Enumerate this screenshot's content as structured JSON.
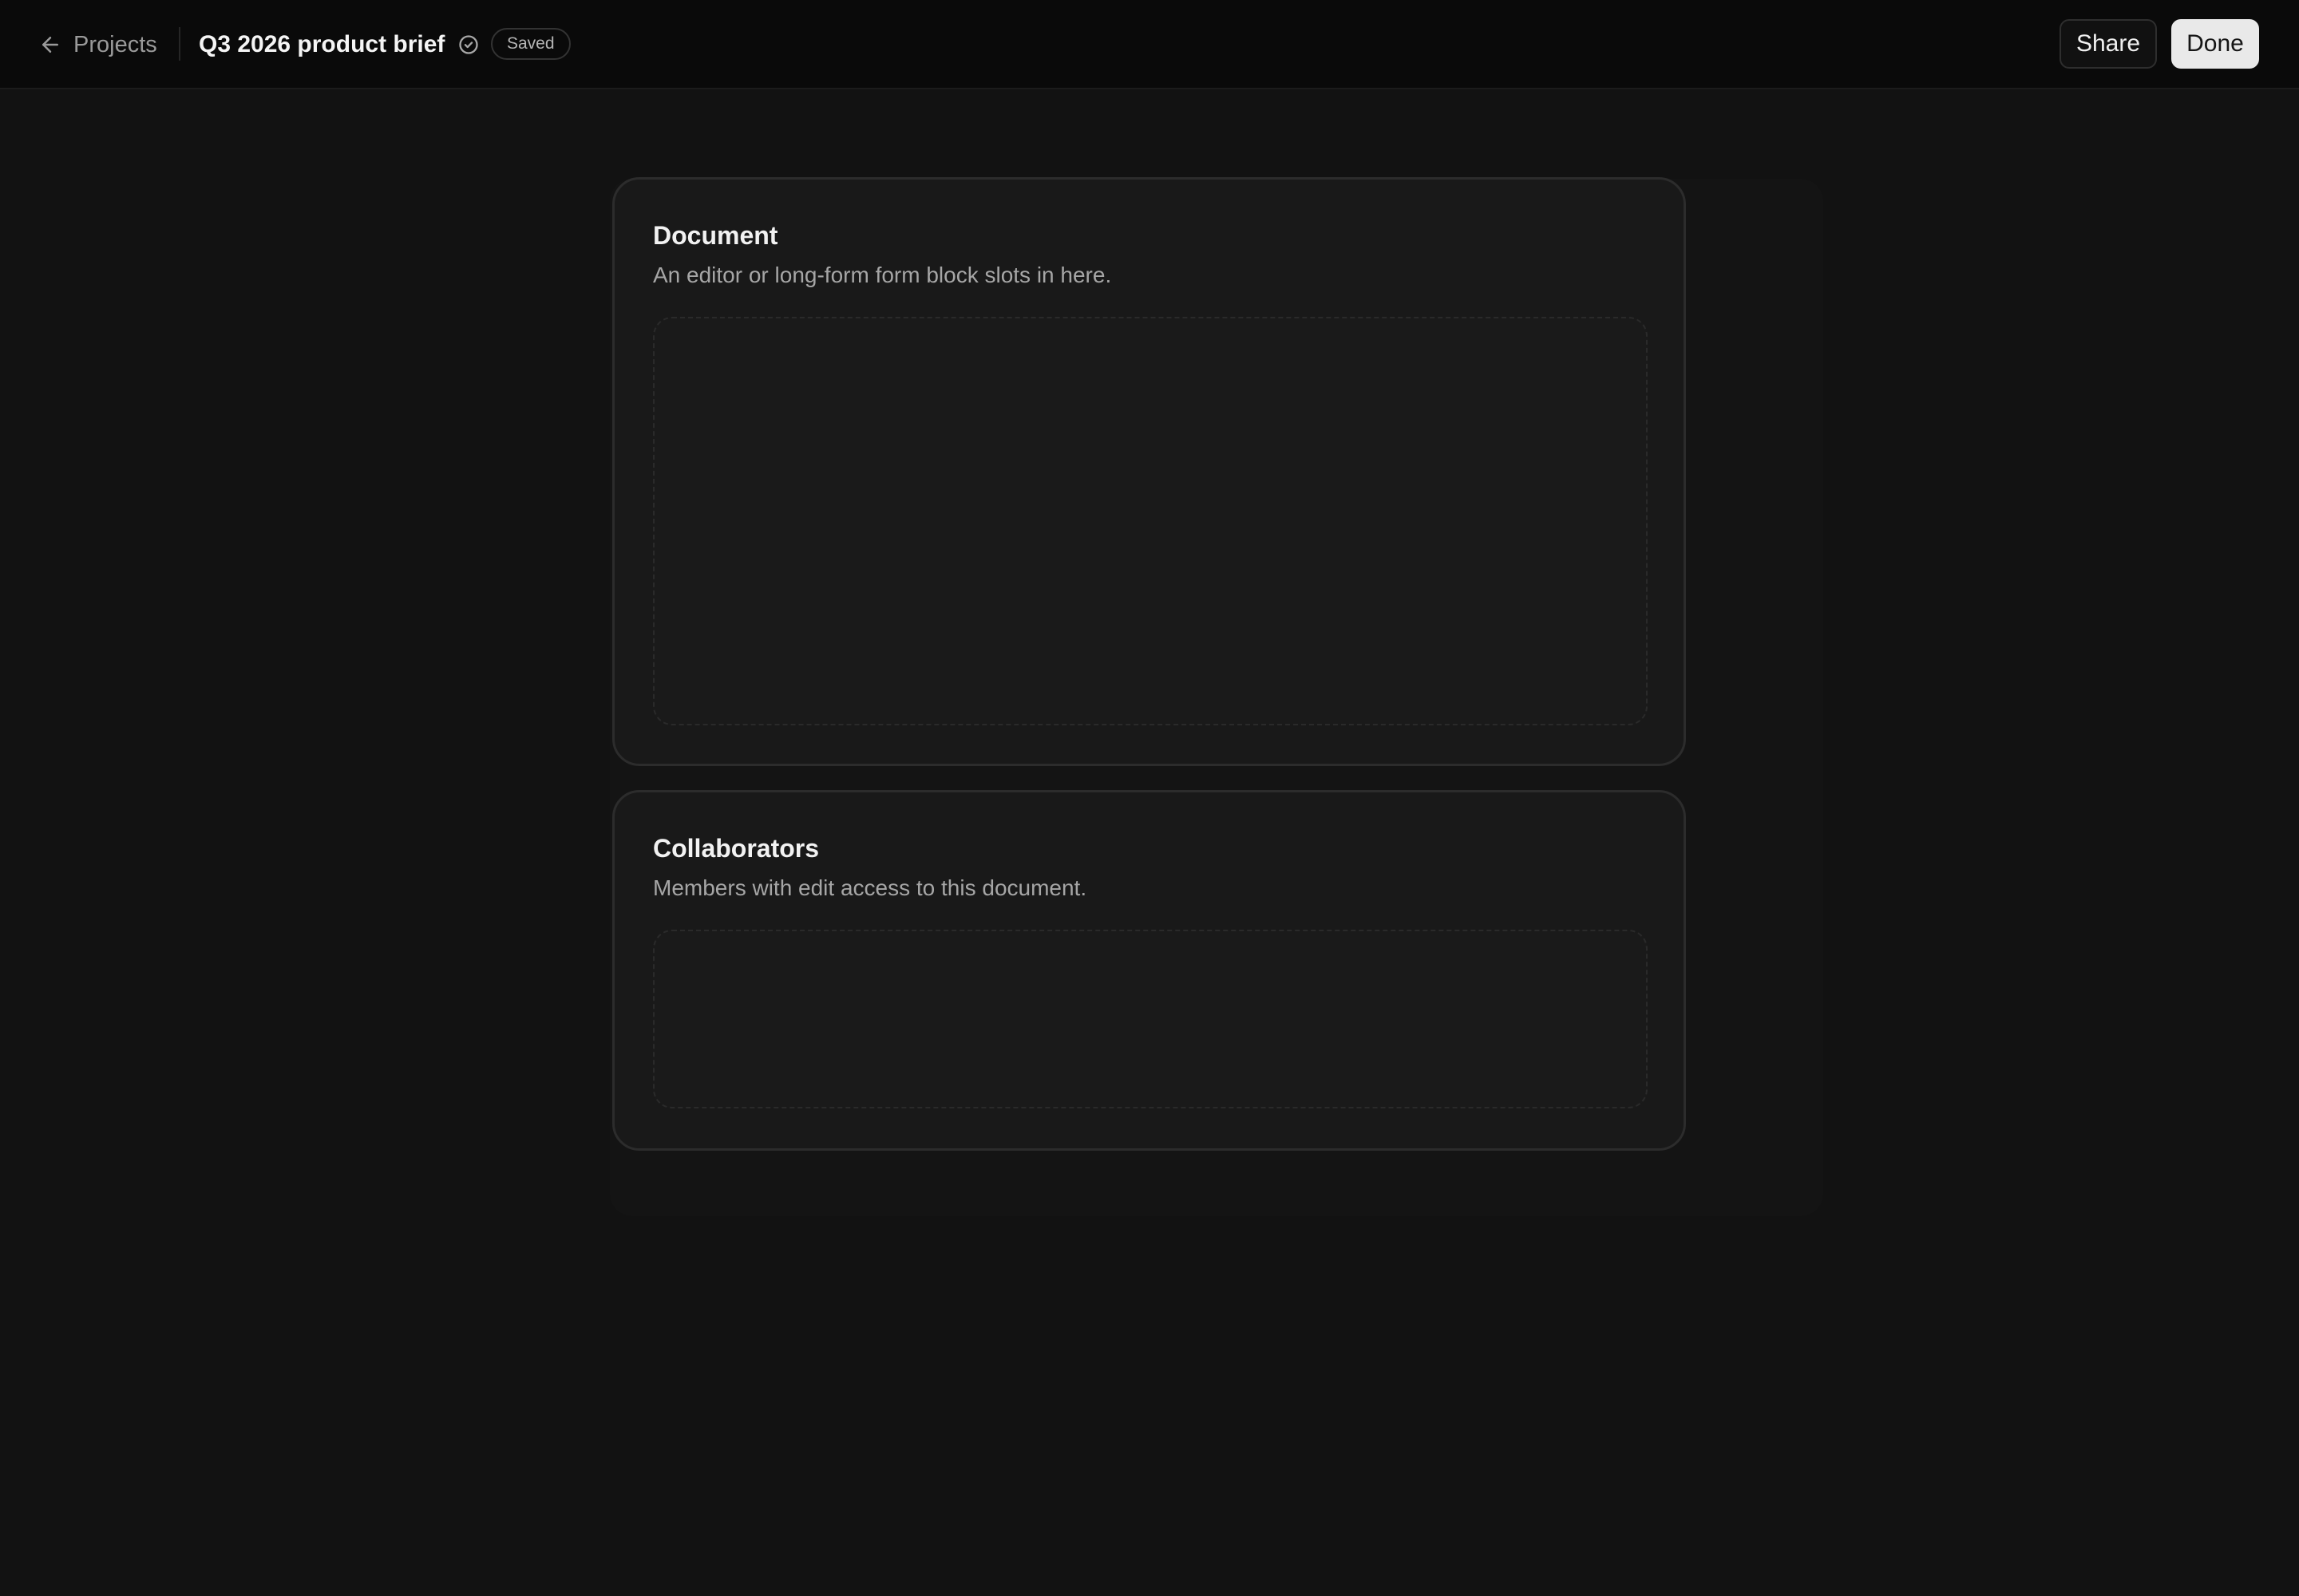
{
  "header": {
    "back_label": "Projects",
    "title": "Q3 2026 product brief",
    "status_badge": "Saved",
    "share_label": "Share",
    "done_label": "Done"
  },
  "sections": [
    {
      "title": "Document",
      "description": "An editor or long-form form block slots in here."
    },
    {
      "title": "Collaborators",
      "description": "Members with edit access to this document."
    }
  ],
  "icons": {
    "back": "arrow-left-icon",
    "saved": "check-circle-icon"
  },
  "colors": {
    "background": "#121212",
    "topbar": "#0a0a0a",
    "card": "#191919",
    "primary_button": "#e9e9e9"
  }
}
